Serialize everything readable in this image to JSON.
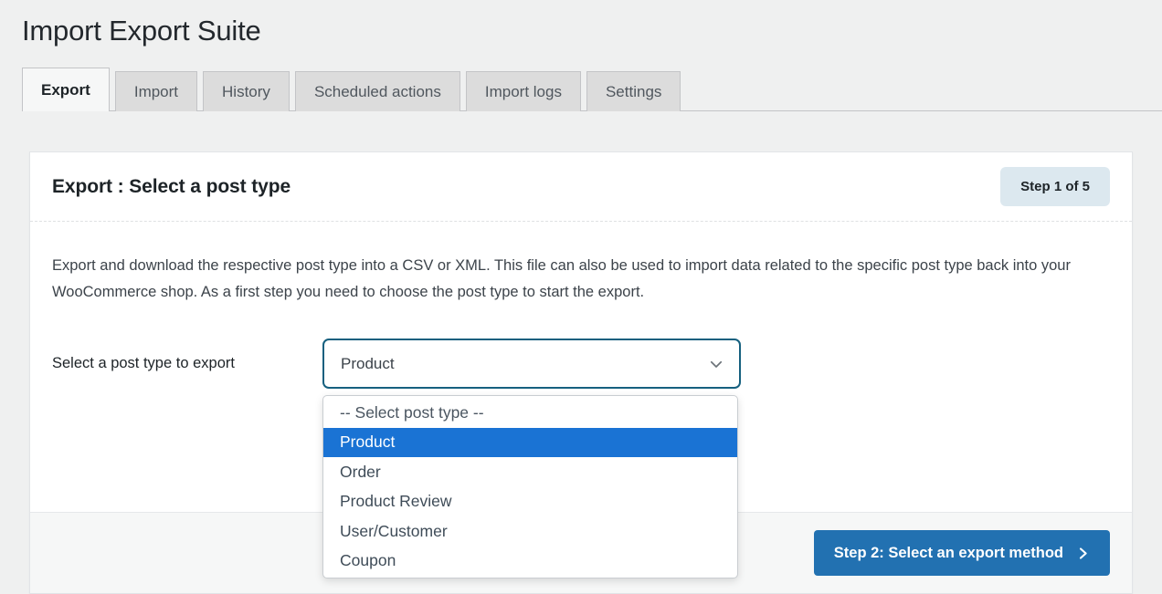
{
  "page": {
    "title": "Import Export Suite"
  },
  "tabs": [
    {
      "label": "Export",
      "active": true
    },
    {
      "label": "Import",
      "active": false
    },
    {
      "label": "History",
      "active": false
    },
    {
      "label": "Scheduled actions",
      "active": false
    },
    {
      "label": "Import logs",
      "active": false
    },
    {
      "label": "Settings",
      "active": false
    }
  ],
  "card": {
    "header_title": "Export : Select a post type",
    "step_badge": "Step 1 of 5",
    "description": "Export and download the respective post type into a CSV or XML. This file can also be used to import data related to the specific post type back into your WooCommerce shop. As a first step you need to choose the post type to start the export.",
    "field_label": "Select a post type to export",
    "select": {
      "value": "Product",
      "placeholder": "-- Select post type --",
      "expanded": true,
      "options": [
        "-- Select post type --",
        "Product",
        "Order",
        "Product Review",
        "User/Customer",
        "Coupon"
      ],
      "selected_index": 1
    },
    "footer": {
      "next_button": "Step 2: Select an export method"
    }
  },
  "colors": {
    "page_background": "#eff0f0",
    "primary_blue": "#2271b1",
    "highlight_blue": "#1a73d4",
    "select_border": "#16607f",
    "badge_background": "#dce8ef"
  }
}
